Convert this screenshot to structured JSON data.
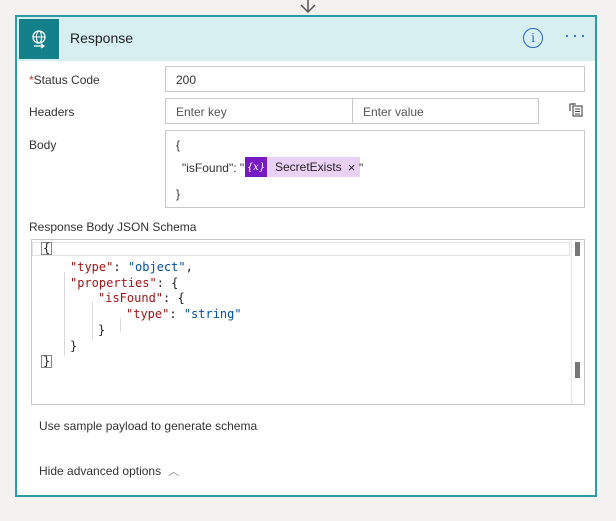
{
  "action": {
    "title": "Response",
    "info_icon_glyph": "i",
    "more_icon_glyph": "···",
    "accent_color": "#14808a"
  },
  "status_code": {
    "label": "Status Code",
    "required_mark": "*",
    "value": "200"
  },
  "headers": {
    "label": "Headers",
    "key_placeholder": "Enter key",
    "value_placeholder": "Enter value"
  },
  "body": {
    "label": "Body",
    "line_open": "{",
    "key_text": "\"isFound\": \"",
    "token_icon": "{x}",
    "token_label": "SecretExists",
    "token_remove": "×",
    "close_quote": "\"",
    "line_close": "}"
  },
  "schema": {
    "label": "Response Body JSON Schema",
    "lines": {
      "l1": "{",
      "l2_key": "\"type\"",
      "l2_sep": ": ",
      "l2_val": "\"object\"",
      "l2_end": ",",
      "l3_key": "\"properties\"",
      "l3_sep": ": {",
      "l4_key": "\"isFound\"",
      "l4_sep": ": {",
      "l5_key": "\"type\"",
      "l5_sep": ": ",
      "l5_val": "\"string\"",
      "l6": "}",
      "l7": "}",
      "l8": "}"
    }
  },
  "links": {
    "sample_payload": "Use sample payload to generate schema",
    "hide_advanced": "Hide advanced options",
    "chevron": "︿"
  }
}
